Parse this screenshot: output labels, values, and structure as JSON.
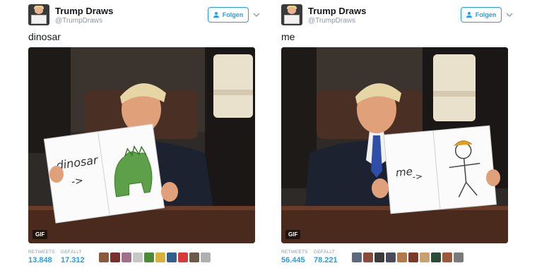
{
  "tweets": [
    {
      "name": "Trump Draws",
      "handle": "@TrumpDraws",
      "follow_label": "Folgen",
      "text": "dinosar",
      "media_badge": "GIF",
      "stats": {
        "retweets_label": "RETWEETS",
        "retweets_value": "13.848",
        "likes_label": "GEFÄLLT",
        "likes_value": "17.312"
      },
      "liker_colors": [
        "#8a5a3c",
        "#7a2f2f",
        "#a0708a",
        "#c7c7c7",
        "#4a8a3a",
        "#d8b13a",
        "#2f5f8a",
        "#d83a3a",
        "#6a5a4a",
        "#b0b0b0"
      ]
    },
    {
      "name": "Trump Draws",
      "handle": "@TrumpDraws",
      "follow_label": "Folgen",
      "text": "me",
      "media_badge": "GIF",
      "stats": {
        "retweets_label": "RETWEETS",
        "retweets_value": "56.445",
        "likes_label": "GEFÄLLT",
        "likes_value": "78.221"
      },
      "liker_colors": [
        "#5a6a7a",
        "#8a4a3a",
        "#3a3a3a",
        "#4a4a5a",
        "#b07a4a",
        "#7a3a2a",
        "#c8a070",
        "#2a4a3a",
        "#9a5a3a",
        "#7a7a7a"
      ]
    }
  ],
  "drawings": {
    "left_sheet_word": "dinosar",
    "left_sheet_arrow": "->",
    "right_sheet_word": "me",
    "right_sheet_arrow": "->"
  }
}
